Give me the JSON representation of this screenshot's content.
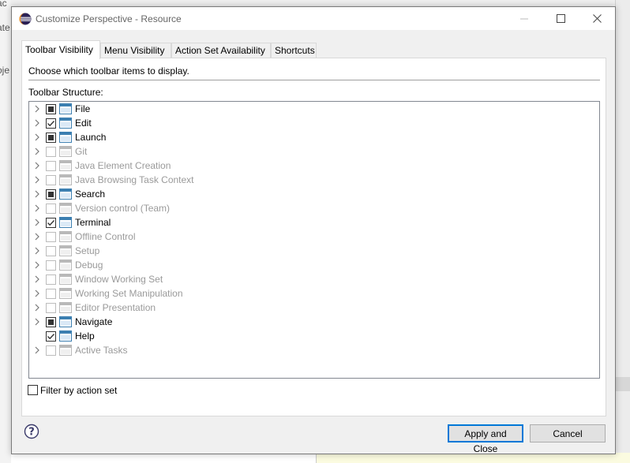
{
  "background": {
    "fragments": [
      "ac",
      "ate",
      "oje"
    ]
  },
  "dialog": {
    "title": "Customize Perspective - Resource",
    "tabs": [
      {
        "label": "Toolbar Visibility",
        "active": true
      },
      {
        "label": "Menu Visibility",
        "active": false
      },
      {
        "label": "Action Set Availability",
        "active": false
      },
      {
        "label": "Shortcuts",
        "active": false
      }
    ],
    "description": "Choose which toolbar items to display.",
    "structure_label": "Toolbar Structure:",
    "tree_items": [
      {
        "label": "File",
        "state": "partial",
        "enabled": true,
        "expandable": true
      },
      {
        "label": "Edit",
        "state": "checked",
        "enabled": true,
        "expandable": true
      },
      {
        "label": "Launch",
        "state": "partial",
        "enabled": true,
        "expandable": true
      },
      {
        "label": "Git",
        "state": "unchecked",
        "enabled": false,
        "expandable": true
      },
      {
        "label": "Java Element Creation",
        "state": "unchecked",
        "enabled": false,
        "expandable": true
      },
      {
        "label": "Java Browsing Task Context",
        "state": "unchecked",
        "enabled": false,
        "expandable": true
      },
      {
        "label": "Search",
        "state": "partial",
        "enabled": true,
        "expandable": true
      },
      {
        "label": "Version control (Team)",
        "state": "unchecked",
        "enabled": false,
        "expandable": true
      },
      {
        "label": "Terminal",
        "state": "checked",
        "enabled": true,
        "expandable": true
      },
      {
        "label": "Offline Control",
        "state": "unchecked",
        "enabled": false,
        "expandable": true
      },
      {
        "label": "Setup",
        "state": "unchecked",
        "enabled": false,
        "expandable": true
      },
      {
        "label": "Debug",
        "state": "unchecked",
        "enabled": false,
        "expandable": true
      },
      {
        "label": "Window Working Set",
        "state": "unchecked",
        "enabled": false,
        "expandable": true
      },
      {
        "label": "Working Set Manipulation",
        "state": "unchecked",
        "enabled": false,
        "expandable": true
      },
      {
        "label": "Editor Presentation",
        "state": "unchecked",
        "enabled": false,
        "expandable": true
      },
      {
        "label": "Navigate",
        "state": "partial",
        "enabled": true,
        "expandable": true
      },
      {
        "label": "Help",
        "state": "checked",
        "enabled": true,
        "expandable": false
      },
      {
        "label": "Active Tasks",
        "state": "unchecked",
        "enabled": false,
        "expandable": true
      }
    ],
    "filter_label": "Filter by action set",
    "apply_label": "Apply and Close",
    "cancel_label": "Cancel",
    "help_glyph": "?"
  },
  "colors": {
    "accent": "#0078d7",
    "disabled_text": "#9a9a9a",
    "icon_blue": "#3c7fb1"
  }
}
